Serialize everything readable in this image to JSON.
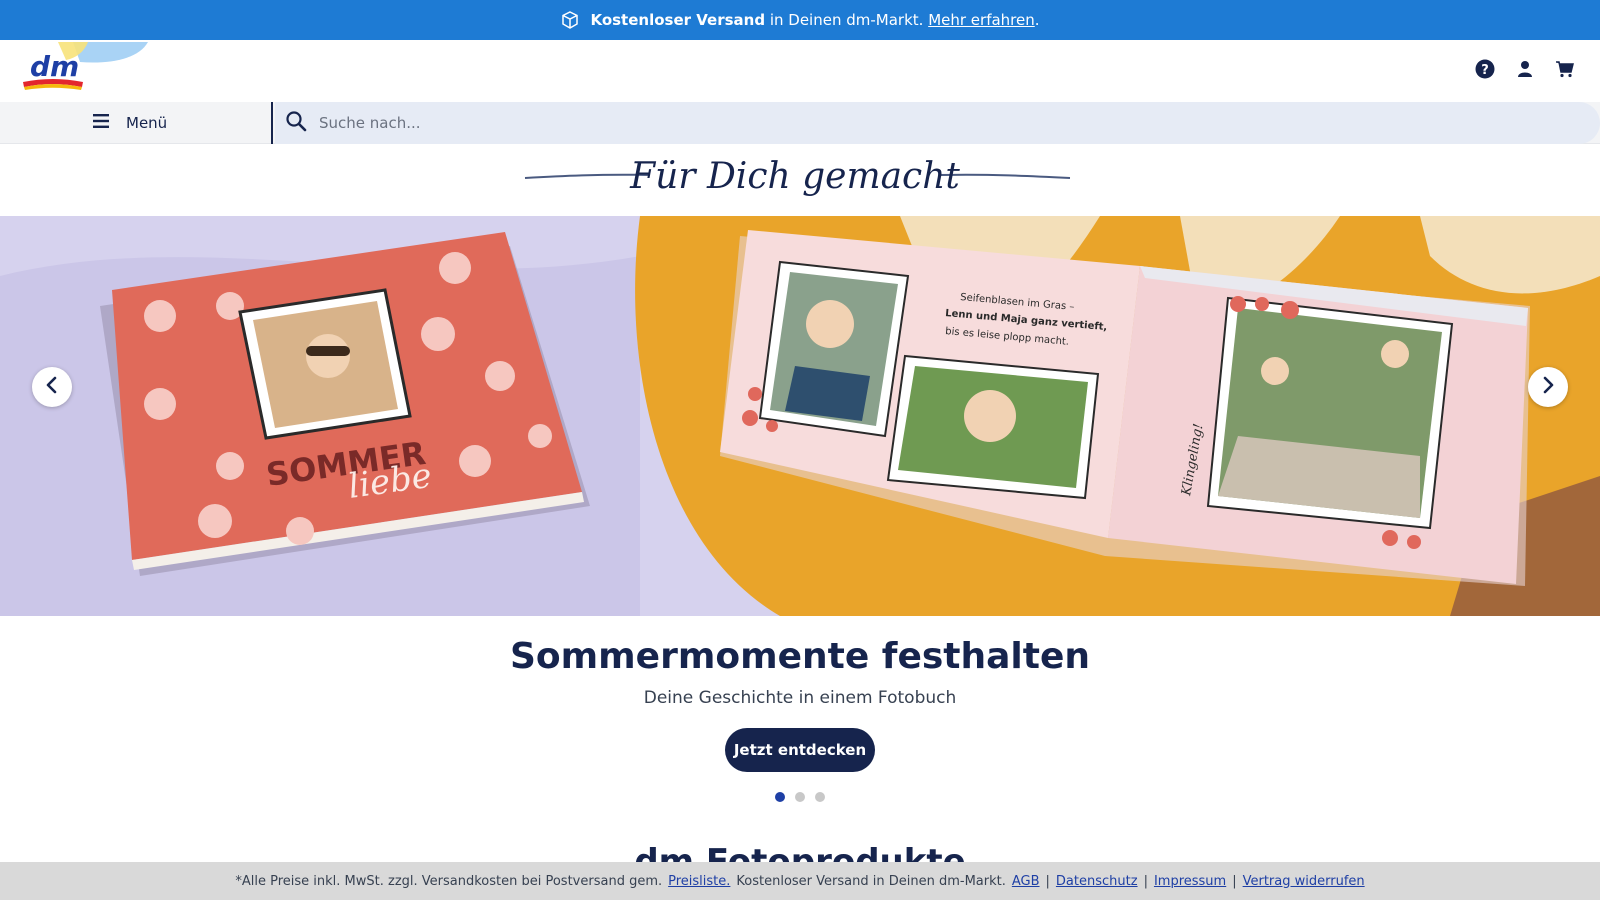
{
  "promo": {
    "bold": "Kostenloser Versand",
    "text": " in Deinen dm-Markt. ",
    "link": "Mehr erfahren",
    "tail": "."
  },
  "header": {
    "logo_text": "dm",
    "icons": [
      "help-icon",
      "account-icon",
      "cart-icon"
    ]
  },
  "nav": {
    "menu_label": "Menü",
    "search_placeholder": "Suche nach..."
  },
  "tagline": "Für Dich gemacht",
  "hero": {
    "cover_text_1": "SOMMER",
    "cover_text_2": "liebe",
    "page_text_1": "Seifenblasen im Gras –",
    "page_text_2": "Lenn und Maja ganz vertieft,",
    "page_text_3": "bis es leise plopp macht.",
    "page_text_4": "Klingeling!"
  },
  "headline": "Sommermomente festhalten",
  "subline": "Deine Geschichte in einem Fotobuch",
  "cta_label": "Jetzt entdecken",
  "carousel": {
    "slides": 3,
    "active": 1
  },
  "section_title": "dm Fotoprodukte",
  "footer": {
    "note": "*Alle Preise inkl. MwSt. zzgl. Versandkosten bei Postversand gem.",
    "price_link": "Preisliste.",
    "shipping": "Kostenloser Versand in Deinen dm-Markt.",
    "links": [
      "AGB",
      "Datenschutz",
      "Impressum",
      "Vertrag widerrufen"
    ],
    "separator": "|"
  },
  "colors": {
    "promo_bg": "#1e7bd4",
    "brand_dark": "#16244d",
    "search_bg": "#e6ebf5",
    "footer_bg": "#d9d9d9",
    "dot_active": "#1e3fa5"
  }
}
